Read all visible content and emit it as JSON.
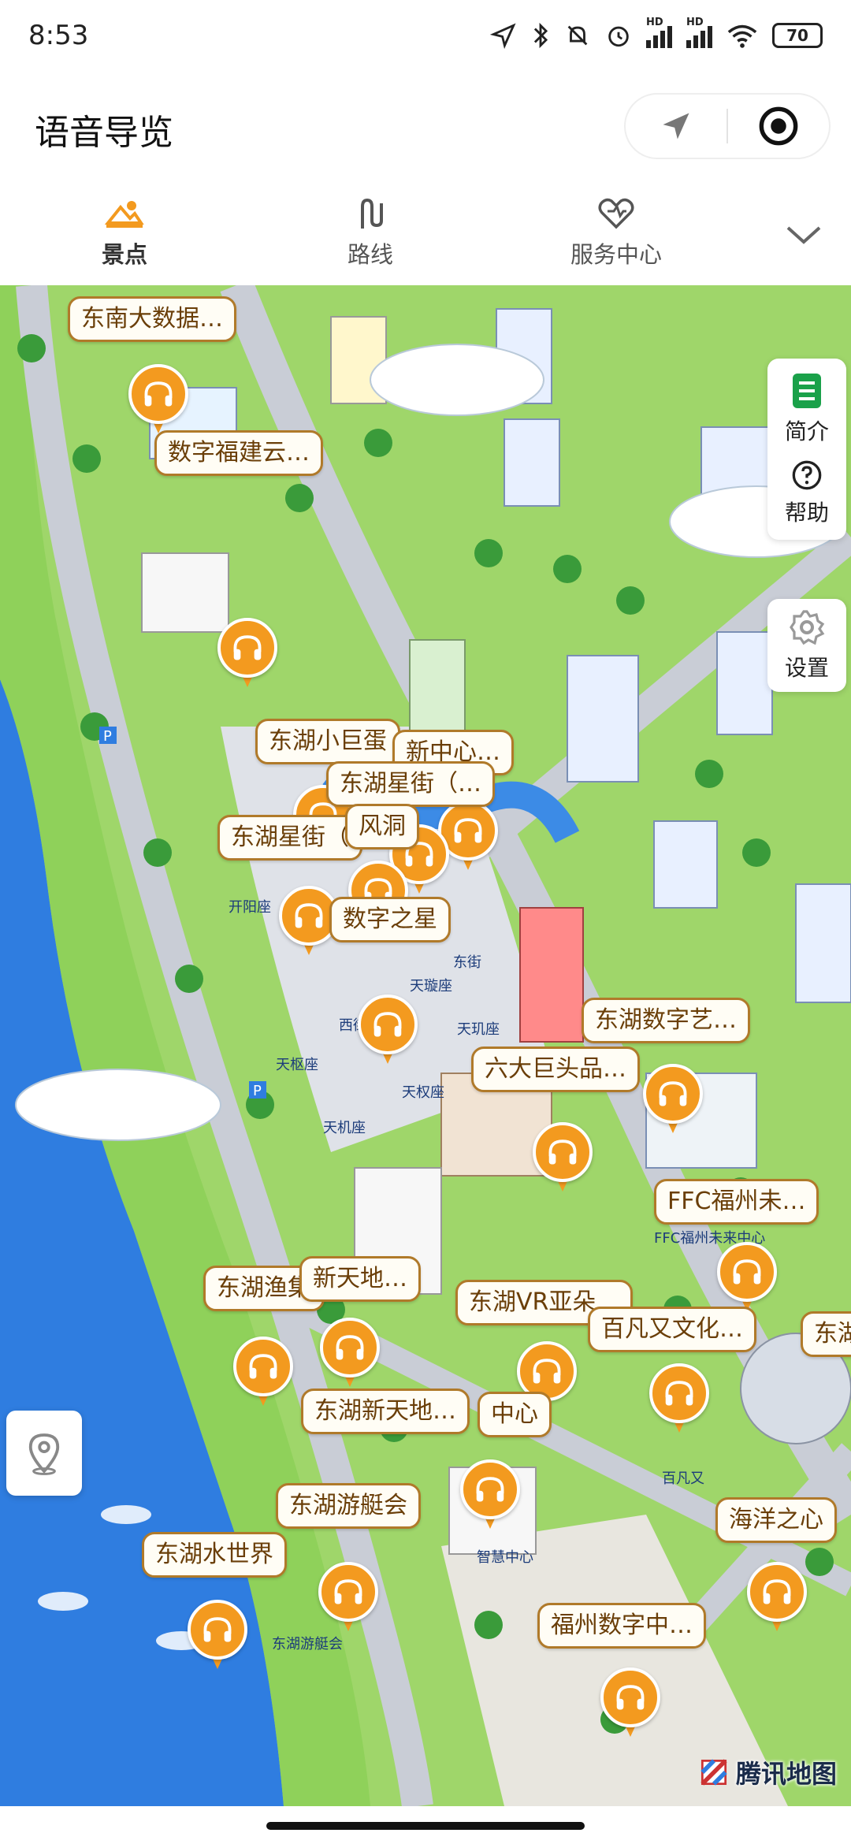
{
  "status_bar": {
    "time": "8:53",
    "battery": "70",
    "network_a": "HD",
    "network_b": "HD"
  },
  "header": {
    "title": "语音导览"
  },
  "tabs": [
    {
      "label": "景点",
      "icon": "scenery-icon",
      "active": true
    },
    {
      "label": "路线",
      "icon": "route-icon",
      "active": false
    },
    {
      "label": "服务中心",
      "icon": "heart-icon",
      "active": false
    }
  ],
  "side_panel": {
    "intro": "简介",
    "help": "帮助",
    "settings": "设置"
  },
  "map": {
    "provider": "腾讯地图",
    "labels": [
      "东南大数据…",
      "数字福建云…",
      "东湖小巨蛋",
      "新中心…",
      "东湖星街（…",
      "东湖星街（",
      "风洞",
      "数字之星",
      "东湖数字艺…",
      "六大巨头品…",
      "FFC福州未…",
      "东湖渔集",
      "新天地…",
      "东湖VR亚朵…",
      "百凡又文化…",
      "东湖",
      "东湖新天地…",
      "中心",
      "东湖游艇会",
      "东湖水世界",
      "海洋之心",
      "福州数字中…"
    ],
    "map_text": [
      "东街",
      "西街",
      "天玑座",
      "天枢座",
      "天权座",
      "天璇座",
      "天机座",
      "开阳座",
      "智慧中心",
      "东湖游艇会",
      "FFC福州未来中心",
      "百凡又"
    ],
    "colors": {
      "marker": "#f39a1f",
      "label_border": "#b07a2a",
      "label_text": "#6a3e08",
      "water": "#2f7de0",
      "grass": "#9fd66a",
      "road": "#c9cdd6"
    }
  }
}
